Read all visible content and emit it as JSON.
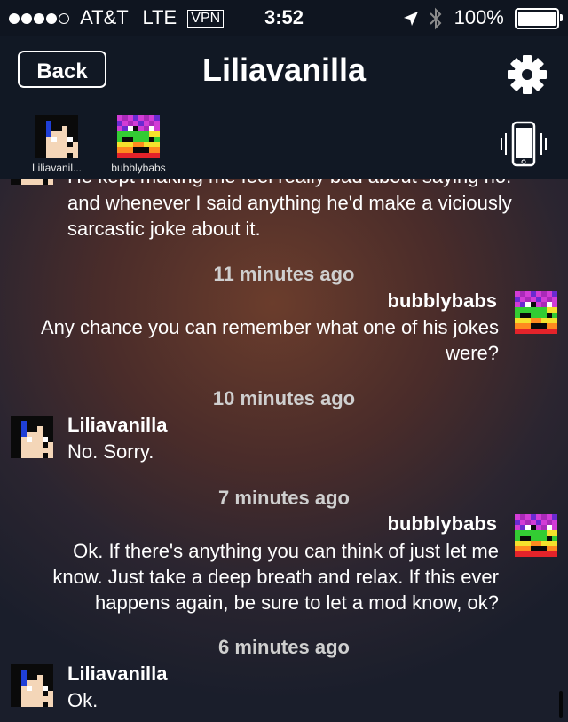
{
  "status_bar": {
    "carrier": "AT&T",
    "network": "LTE",
    "vpn": "VPN",
    "time": "3:52",
    "battery": "100%",
    "signal_strength": 4
  },
  "nav": {
    "back_label": "Back",
    "title": "Liliavanilla"
  },
  "participants": [
    {
      "name": "Liliavanil...",
      "icon": "liliavanilla-avatar"
    },
    {
      "name": "bubblybabs",
      "icon": "bubblybabs-avatar"
    }
  ],
  "messages": {
    "partial_top": {
      "line0": "He kept making me feel really bad about saying no.",
      "line1": "and whenever I said anything he'd make a viciously",
      "line2": "sarcastic joke about it."
    },
    "group1": {
      "timestamp": "11 minutes ago",
      "sender": "bubblybabs",
      "line1": "Any chance you can remember what one of his jokes",
      "line2": "were?"
    },
    "group2": {
      "timestamp": "10 minutes ago",
      "sender": "Liliavanilla",
      "line1": "No. Sorry."
    },
    "group3": {
      "timestamp": "7 minutes ago",
      "sender": "bubblybabs",
      "line1": "Ok.  If there's anything you can think of just let me",
      "line2": "know.  Just take a deep breath and relax.  If this ever",
      "line3": "happens again, be sure to let a mod know, ok?"
    },
    "group4": {
      "timestamp": "6 minutes ago",
      "sender": "Liliavanilla",
      "line1": "Ok."
    }
  }
}
